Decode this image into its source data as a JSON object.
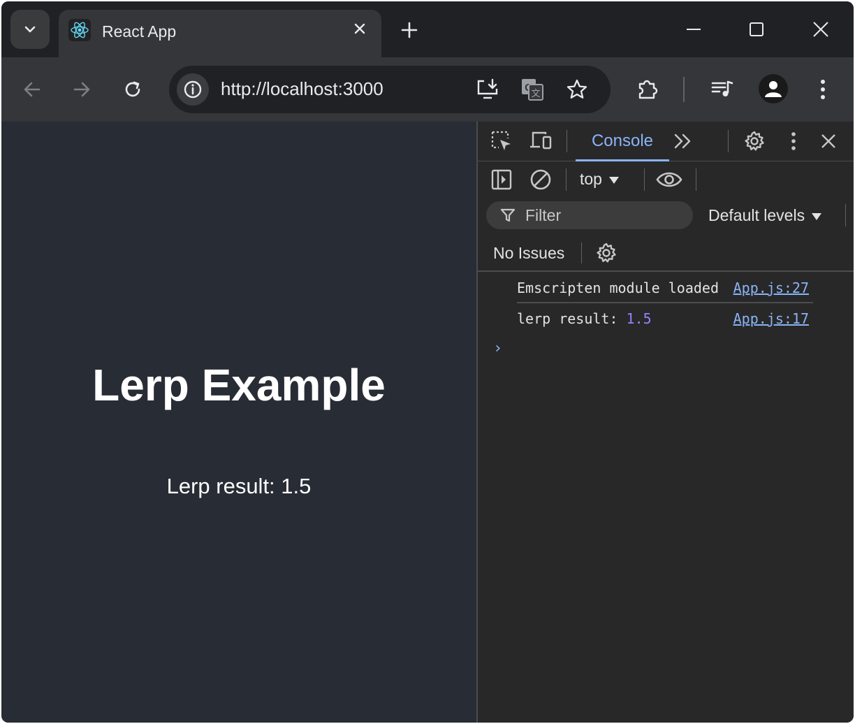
{
  "tab": {
    "title": "React App"
  },
  "omnibox": {
    "url": "http://localhost:3000"
  },
  "page": {
    "heading": "Lerp Example",
    "result_text": "Lerp result: 1.5"
  },
  "devtools": {
    "active_tab": "Console",
    "context": "top",
    "filter_placeholder": "Filter",
    "levels": "Default levels",
    "issues": "No Issues",
    "logs": [
      {
        "message": "Emscripten module loaded",
        "source": "App.js:27"
      },
      {
        "label": "lerp result:",
        "value": "1.5",
        "source": "App.js:17"
      }
    ],
    "prompt": "›"
  },
  "colors": {
    "page_bg": "#282c34",
    "devtools_bg": "#282828",
    "accent": "#8ab4f8",
    "number": "#9980ff"
  }
}
